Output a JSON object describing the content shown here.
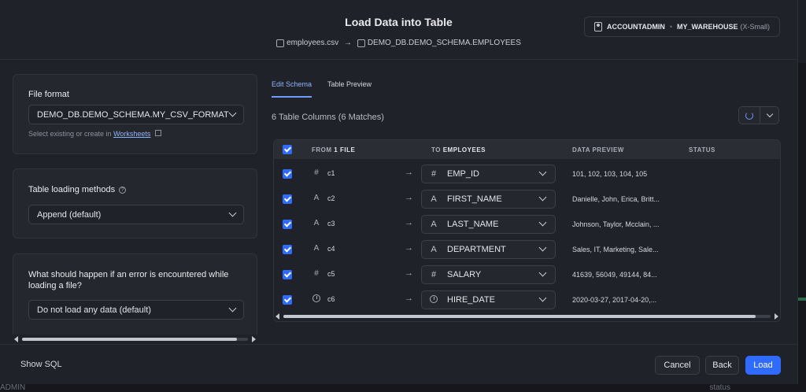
{
  "dialog": {
    "title": "Load Data into Table",
    "source_file": "employees.csv",
    "arrow": "→",
    "target_table": "DEMO_DB.DEMO_SCHEMA.EMPLOYEES"
  },
  "role": {
    "name": "ACCOUNTADMIN",
    "separator": "•",
    "warehouse": "MY_WAREHOUSE",
    "size": "(X-Small)"
  },
  "left": {
    "file_format": {
      "label": "File format",
      "value": "DEMO_DB.DEMO_SCHEMA.MY_CSV_FORMAT",
      "hint_prefix": "Select existing or create in",
      "hint_link": "Worksheets"
    },
    "loading_methods": {
      "label": "Table loading methods",
      "help": "?",
      "value": "Append (default)"
    },
    "on_error": {
      "label": "What should happen if an error is encountered while loading a file?",
      "value": "Do not load any data (default)"
    },
    "scroll_fraction": 0.95
  },
  "tabs": [
    {
      "label": "Edit Schema",
      "active": true
    },
    {
      "label": "Table Preview",
      "active": false
    }
  ],
  "columns_summary": "6 Table Columns (6 Matches)",
  "table": {
    "headers": {
      "from_prefix": "FROM",
      "from_bold": "1 FILE",
      "to_prefix": "TO",
      "to_bold": "EMPLOYEES",
      "preview": "DATA PREVIEW",
      "status": "STATUS"
    },
    "rows": [
      {
        "source": "c1",
        "type_icon": "#",
        "target": "EMP_ID",
        "preview": "101, 102, 103, 104, 105"
      },
      {
        "source": "c2",
        "type_icon": "A",
        "target": "FIRST_NAME",
        "preview": "Danielle, John, Erica, Britt..."
      },
      {
        "source": "c3",
        "type_icon": "A",
        "target": "LAST_NAME",
        "preview": "Johnson, Taylor, Mcclain, ..."
      },
      {
        "source": "c4",
        "type_icon": "A",
        "target": "DEPARTMENT",
        "preview": "Sales, IT, Marketing, Sale..."
      },
      {
        "source": "c5",
        "type_icon": "#",
        "target": "SALARY",
        "preview": "41639, 56049, 49144, 84..."
      },
      {
        "source": "c6",
        "type_icon": "clock",
        "target": "HIRE_DATE",
        "preview": "2020-03-27, 2017-04-20,..."
      }
    ],
    "arrow": "→",
    "scroll_fraction": 0.97
  },
  "footer": {
    "show_sql": "Show SQL",
    "cancel": "Cancel",
    "back": "Back",
    "load": "Load"
  },
  "background": {
    "admin_text": "ADMIN",
    "status_text": "status"
  },
  "colors": {
    "accent": "#2f6bff",
    "link": "#8fb4ff"
  }
}
